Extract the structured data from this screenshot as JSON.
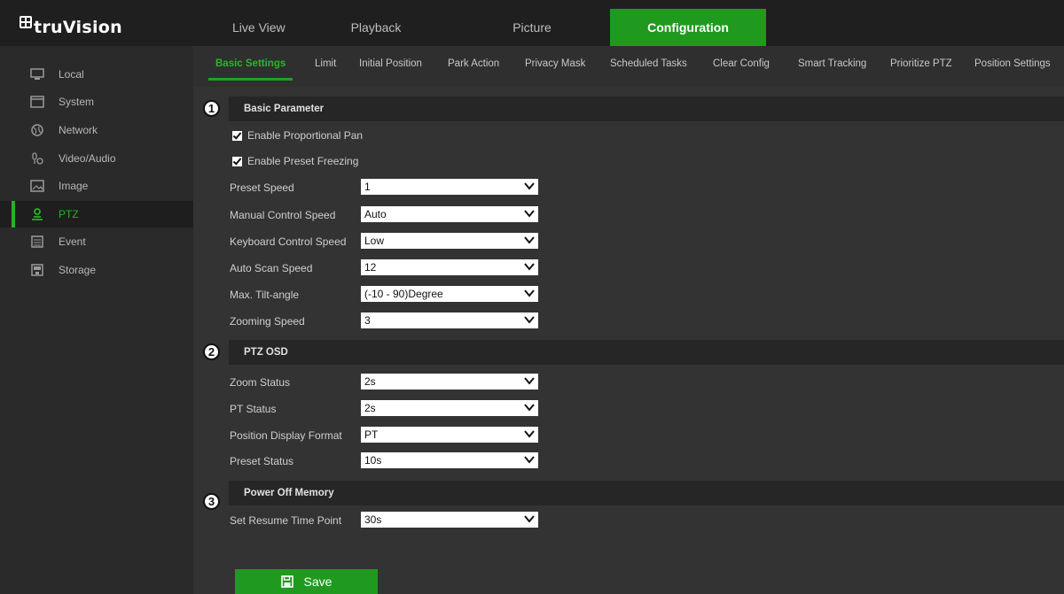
{
  "brand": {
    "name": "truVision"
  },
  "main_tabs": [
    {
      "label": "Live View"
    },
    {
      "label": "Playback"
    },
    {
      "label": "Picture"
    },
    {
      "label": "Configuration",
      "active": true
    }
  ],
  "sidebar": {
    "items": [
      {
        "label": "Local",
        "icon": "monitor-icon"
      },
      {
        "label": "System",
        "icon": "window-icon"
      },
      {
        "label": "Network",
        "icon": "globe-icon"
      },
      {
        "label": "Video/Audio",
        "icon": "mic-icon"
      },
      {
        "label": "Image",
        "icon": "image-icon"
      },
      {
        "label": "PTZ",
        "icon": "ptz-icon",
        "active": true
      },
      {
        "label": "Event",
        "icon": "calendar-icon"
      },
      {
        "label": "Storage",
        "icon": "disk-icon"
      }
    ]
  },
  "sub_tabs": [
    {
      "label": "Basic Settings",
      "active": true
    },
    {
      "label": "Limit"
    },
    {
      "label": "Initial Position"
    },
    {
      "label": "Park Action"
    },
    {
      "label": "Privacy Mask"
    },
    {
      "label": "Scheduled Tasks"
    },
    {
      "label": "Clear Config"
    },
    {
      "label": "Smart Tracking"
    },
    {
      "label": "Prioritize PTZ"
    },
    {
      "label": "Position Settings"
    }
  ],
  "basic_parameter": {
    "badge": "1",
    "title": "Basic Parameter",
    "checkboxes": [
      {
        "label": "Enable Proportional Pan",
        "checked": true
      },
      {
        "label": "Enable Preset Freezing",
        "checked": true
      }
    ],
    "fields": [
      {
        "label": "Preset Speed",
        "value": "1"
      },
      {
        "label": "Manual Control Speed",
        "value": "Auto"
      },
      {
        "label": "Keyboard Control Speed",
        "value": "Low"
      },
      {
        "label": "Auto Scan Speed",
        "value": "12"
      },
      {
        "label": "Max. Tilt-angle",
        "value": "(-10 - 90)Degree"
      },
      {
        "label": "Zooming Speed",
        "value": "3"
      }
    ]
  },
  "ptz_osd": {
    "badge": "2",
    "title": "PTZ OSD",
    "fields": [
      {
        "label": "Zoom Status",
        "value": "2s"
      },
      {
        "label": "PT Status",
        "value": "2s"
      },
      {
        "label": "Position Display Format",
        "value": "PT"
      },
      {
        "label": "Preset Status",
        "value": "10s"
      }
    ]
  },
  "power_off_memory": {
    "badge": "3",
    "title": "Power Off Memory",
    "fields": [
      {
        "label": "Set Resume Time Point",
        "value": "30s"
      }
    ]
  },
  "save_button": {
    "label": "Save",
    "icon": "floppy-icon"
  },
  "colors": {
    "accent": "#1f9a1f",
    "active_text": "#22b522"
  }
}
